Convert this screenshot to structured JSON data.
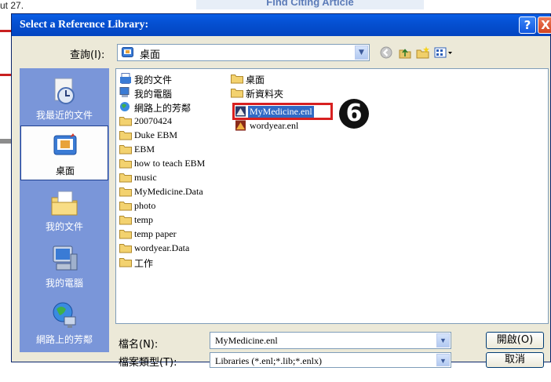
{
  "background": {
    "top_left_text": "ut 27.",
    "title_fragment": "Find Citing Article"
  },
  "dialog": {
    "title": "Select a Reference Library:",
    "help_label": "?",
    "close_label": "X",
    "look_in": {
      "label": "查詢(I):",
      "value": "桌面"
    },
    "places": [
      {
        "label": "我最近的文件",
        "icon": "recent-docs-icon"
      },
      {
        "label": "桌面",
        "icon": "desktop-icon",
        "selected": true
      },
      {
        "label": "我的文件",
        "icon": "my-documents-icon"
      },
      {
        "label": "我的電腦",
        "icon": "my-computer-icon"
      },
      {
        "label": "網路上的芳鄰",
        "icon": "network-icon"
      }
    ],
    "files_col1": [
      {
        "name": "我的文件",
        "icon": "documents-icon"
      },
      {
        "name": "我的電腦",
        "icon": "computer-icon"
      },
      {
        "name": "網路上的芳鄰",
        "icon": "network-icon"
      },
      {
        "name": "20070424",
        "icon": "folder-icon"
      },
      {
        "name": "Duke EBM",
        "icon": "folder-icon"
      },
      {
        "name": "EBM",
        "icon": "folder-icon"
      },
      {
        "name": "how to teach EBM",
        "icon": "folder-icon"
      },
      {
        "name": "music",
        "icon": "folder-icon"
      },
      {
        "name": "MyMedicine.Data",
        "icon": "folder-icon"
      },
      {
        "name": "photo",
        "icon": "folder-icon"
      },
      {
        "name": "temp",
        "icon": "folder-icon"
      },
      {
        "name": "temp paper",
        "icon": "folder-icon"
      },
      {
        "name": "wordyear.Data",
        "icon": "folder-icon"
      },
      {
        "name": "工作",
        "icon": "folder-icon"
      }
    ],
    "files_col2": [
      {
        "name": "桌面",
        "icon": "folder-icon"
      },
      {
        "name": "新資料夾",
        "icon": "folder-icon"
      },
      {
        "name": "MyMedicine.enl",
        "icon": "endnote-library-icon",
        "selected": true
      },
      {
        "name": "wordyear.enl",
        "icon": "endnote-library-icon"
      }
    ],
    "callout_number": "6",
    "filename": {
      "label": "檔名(N):",
      "value": "MyMedicine.enl"
    },
    "filetype": {
      "label": "檔案類型(T):",
      "value": "Libraries (*.enl;*.lib;*.enlx)"
    },
    "open_button": "開啟(O)",
    "cancel_button": "取消",
    "colors": {
      "titlebar": "#0550d2",
      "places_panel": "#7a96d9",
      "selection": "#316ac5",
      "callout_box": "#d82020"
    }
  }
}
